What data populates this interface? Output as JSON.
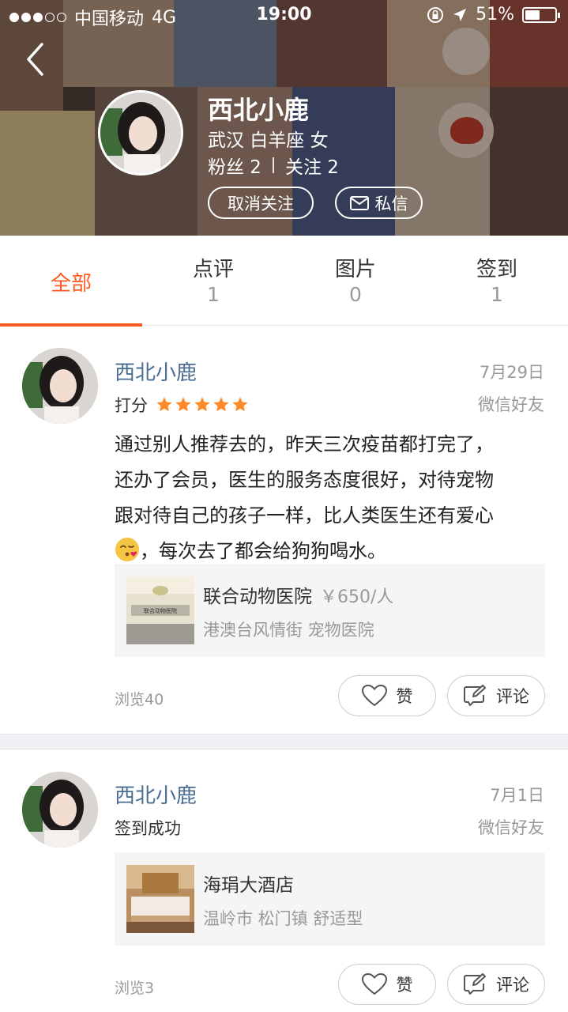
{
  "status_bar": {
    "carrier": "中国移动",
    "network": "4G",
    "time": "19:00",
    "battery": "51%",
    "battery_level": 0.51,
    "signal_bars_filled": 3,
    "signal_bars_total": 5
  },
  "profile": {
    "name": "西北小鹿",
    "meta": "武汉 白羊座 女",
    "fans": "粉丝 2",
    "following": "关注 2",
    "unfollow_label": "取消关注",
    "message_label": "私信"
  },
  "tabs": [
    {
      "label": "全部",
      "count": ""
    },
    {
      "label": "点评",
      "count": "1"
    },
    {
      "label": "图片",
      "count": "0"
    },
    {
      "label": "签到",
      "count": "1"
    }
  ],
  "feed": [
    {
      "name": "西北小鹿",
      "date": "7月29日",
      "source": "微信好友",
      "rating_label": "打分",
      "rating": 5,
      "text_lines": [
        "通过别人推荐去的，昨天三次疫苗都打完了，",
        "还办了会员，医生的服务态度很好，对待宠物",
        "跟对待自己的孩子一样，比人类医生还有爱心",
        "，每次去了都会给狗狗喝水。"
      ],
      "business": {
        "name": "联合动物医院",
        "price": "￥650/人",
        "sub": "港澳台风情街 宠物医院",
        "thumb_text": "联合动物医院"
      },
      "views": "浏览40",
      "like_label": "赞",
      "comment_label": "评论"
    },
    {
      "name": "西北小鹿",
      "date": "7月1日",
      "source": "微信好友",
      "action": "签到成功",
      "business": {
        "name": "海琄大酒店",
        "sub": "温岭市 松门镇 舒适型"
      },
      "views": "浏览3",
      "like_label": "赞",
      "comment_label": "评论"
    }
  ],
  "colors": {
    "accent": "#ff5a1f",
    "name_link": "#4b6d92",
    "star": "#ff8a2b",
    "muted": "#999999"
  },
  "icons": [
    "back-chevron-icon",
    "lock-rotation-icon",
    "location-arrow-icon",
    "battery-icon",
    "mail-icon",
    "heart-icon",
    "edit-comment-icon",
    "star-icon",
    "kiss-emoji-icon"
  ]
}
